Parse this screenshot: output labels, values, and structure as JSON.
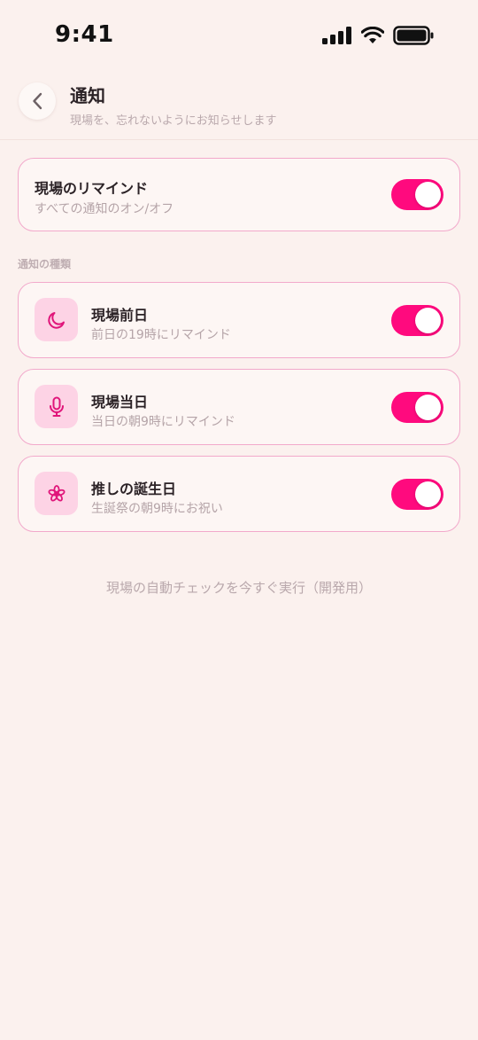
{
  "status_bar": {
    "time": "9:41"
  },
  "header": {
    "title": "通知",
    "subtitle": "現場を、忘れないようにお知らせします"
  },
  "master": {
    "title": "現場のリマインド",
    "description": "すべての通知のオン/オフ",
    "enabled": true
  },
  "section": {
    "label": "通知の種類"
  },
  "items": [
    {
      "icon": "moon-icon",
      "title": "現場前日",
      "description": "前日の19時にリマインド",
      "enabled": true
    },
    {
      "icon": "microphone-icon",
      "title": "現場当日",
      "description": "当日の朝9時にリマインド",
      "enabled": true
    },
    {
      "icon": "flower-icon",
      "title": "推しの誕生日",
      "description": "生誕祭の朝9時にお祝い",
      "enabled": true
    }
  ],
  "dev_action": {
    "label": "現場の自動チェックを今すぐ実行（開発用）"
  },
  "colors": {
    "accent": "#FF0A7E",
    "background": "#FBF1EE",
    "card_border": "#F2A9CB",
    "icon_bg": "#FDD3E5"
  }
}
